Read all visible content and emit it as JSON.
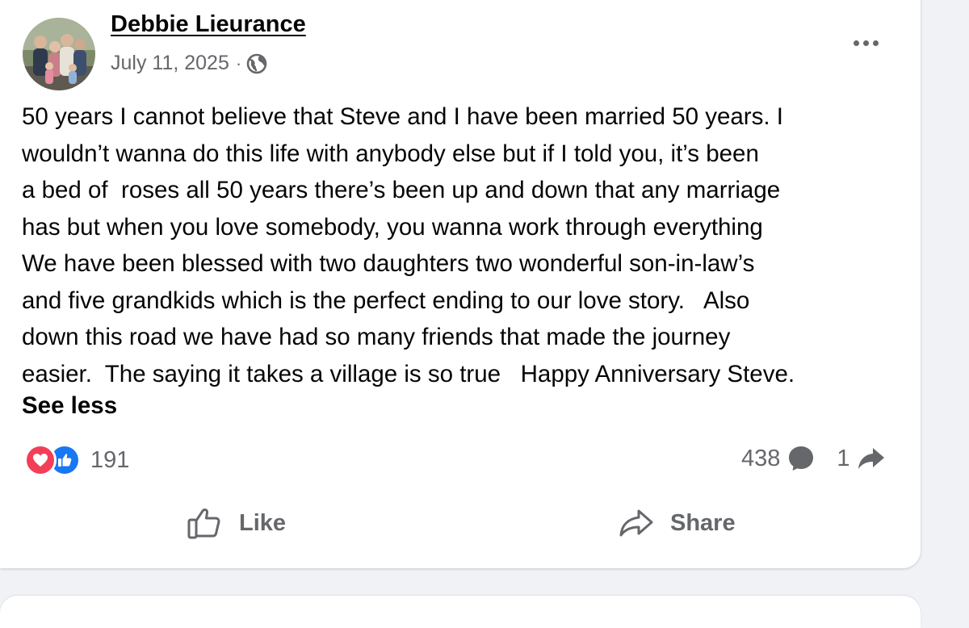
{
  "post": {
    "author": "Debbie Lieurance",
    "date": "July 11, 2025",
    "separator": "·",
    "privacy_icon": "globe-icon",
    "body_lines": [
      "50 years I cannot believe that Steve and I have been married 50 years. I",
      "wouldn’t wanna do this life with anybody else but if I told you, it’s been",
      "a bed of  roses all 50 years there’s been up and down that any marriage",
      "has but when you love somebody, you wanna work through everything",
      "We have been blessed with two daughters two wonderful son-in-law’s",
      "and five grandkids which is the perfect ending to our love story.   Also",
      "down this road we have had so many friends that made the journey",
      "easier.  The saying it takes a village is so true   Happy Anniversary Steve."
    ],
    "see_less": "See less"
  },
  "stats": {
    "reaction_count": "191",
    "reaction_icons": [
      "love-icon",
      "like-icon"
    ],
    "comment_count": "438",
    "share_count": "1"
  },
  "actions": {
    "like_label": "Like",
    "share_label": "Share"
  },
  "colors": {
    "text_primary": "#050505",
    "text_secondary": "#65676b",
    "like_blue": "#1877f2",
    "love_red": "#f33e58",
    "page_bg": "#f0f2f5"
  }
}
